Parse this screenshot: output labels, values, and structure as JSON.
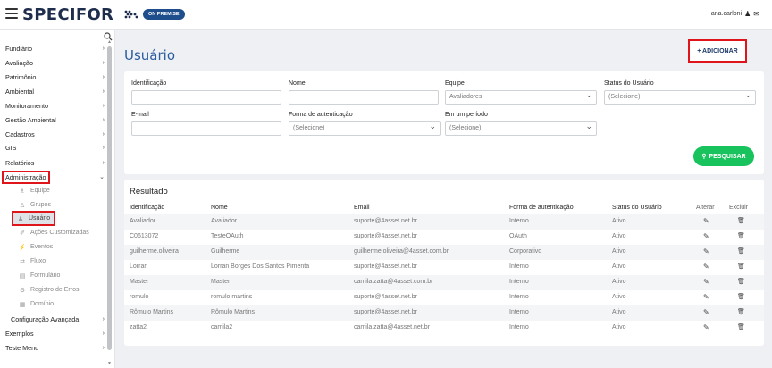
{
  "header": {
    "logo_text": "SPECIFOR",
    "badge": "ON PREMISE",
    "user": "ana.carloni"
  },
  "sidebar": {
    "items": [
      {
        "label": "Fundiário",
        "chevron": "›"
      },
      {
        "label": "Avaliação",
        "chevron": "›"
      },
      {
        "label": "Patrimônio",
        "chevron": "›"
      },
      {
        "label": "Ambiental",
        "chevron": "›"
      },
      {
        "label": "Monitoramento",
        "chevron": "›"
      },
      {
        "label": "Gestão Ambiental",
        "chevron": "›"
      },
      {
        "label": "Cadastros",
        "chevron": "›"
      },
      {
        "label": "GIS",
        "chevron": "›"
      },
      {
        "label": "Relatórios",
        "chevron": "›"
      },
      {
        "label": "Administração",
        "chevron": "⌄"
      }
    ],
    "sub_items": [
      {
        "label": "Equipe",
        "icon": "team-icon"
      },
      {
        "label": "Grupos",
        "icon": "groups-icon"
      },
      {
        "label": "Usuário",
        "icon": "user-icon"
      },
      {
        "label": "Ações Customizadas",
        "icon": "custom-actions-icon"
      },
      {
        "label": "Eventos",
        "icon": "events-icon"
      },
      {
        "label": "Fluxo",
        "icon": "flow-icon"
      },
      {
        "label": "Formulário",
        "icon": "form-icon"
      },
      {
        "label": "Registro de Erros",
        "icon": "error-log-icon"
      },
      {
        "label": "Domínio",
        "icon": "domain-icon"
      }
    ],
    "bottom_items": [
      {
        "label": "Configuração Avançada",
        "chevron": "›"
      },
      {
        "label": "Exemplos",
        "chevron": "›"
      },
      {
        "label": "Teste Menu",
        "chevron": "›"
      }
    ]
  },
  "main": {
    "title": "Usuário",
    "add_button": "+ ADICIONAR",
    "more_icon": "⋮"
  },
  "filters": {
    "identificacao_label": "Identificação",
    "identificacao_value": "",
    "nome_label": "Nome",
    "nome_value": "",
    "equipe_label": "Equipe",
    "equipe_value": "Avaliadores",
    "status_label": "Status do Usuário",
    "status_value": "(Selecione)",
    "email_label": "E-mail",
    "email_value": "",
    "auth_label": "Forma de autenticação",
    "auth_value": "(Selecione)",
    "periodo_label": "Em um período",
    "periodo_value": "(Selecione)",
    "search_button": "PESQUISAR"
  },
  "results": {
    "title": "Resultado",
    "columns": [
      "Identificação",
      "Nome",
      "Email",
      "Forma de autenticação",
      "Status do Usuário",
      "Alterar",
      "Excluir"
    ],
    "rows": [
      [
        "Avaliador",
        "Avaliador",
        "suporte@4asset.net.br",
        "Interno",
        "Ativo"
      ],
      [
        "C0613072",
        "TesteOAuth",
        "suporte@4asset.net.br",
        "OAuth",
        "Ativo"
      ],
      [
        "guilherme.oliveira",
        "Guilherme",
        "guilherme.oliveira@4asset.com.br",
        "Corporativo",
        "Ativo"
      ],
      [
        "Lorran",
        "Lorran Borges Dos Santos Pimenta",
        "suporte@4asset.net.br",
        "Interno",
        "Ativo"
      ],
      [
        "Master",
        "Master",
        "camila.zatta@4asset.com.br",
        "Interno",
        "Ativo"
      ],
      [
        "romulo",
        "romulo martins",
        "suporte@4asset.net.br",
        "Interno",
        "Ativo"
      ],
      [
        "Rômulo Martins",
        "Rômulo Martins",
        "suporte@4asset.net.br",
        "Interno",
        "Ativo"
      ],
      [
        "zatta2",
        "camila2",
        "camila.zatta@4asset.net.br",
        "Interno",
        "Ativo"
      ]
    ]
  },
  "colors": {
    "brand": "#1f2d4d",
    "title_blue": "#2a5d9f",
    "highlight": "#e0141b",
    "search_green": "#18c25c"
  }
}
